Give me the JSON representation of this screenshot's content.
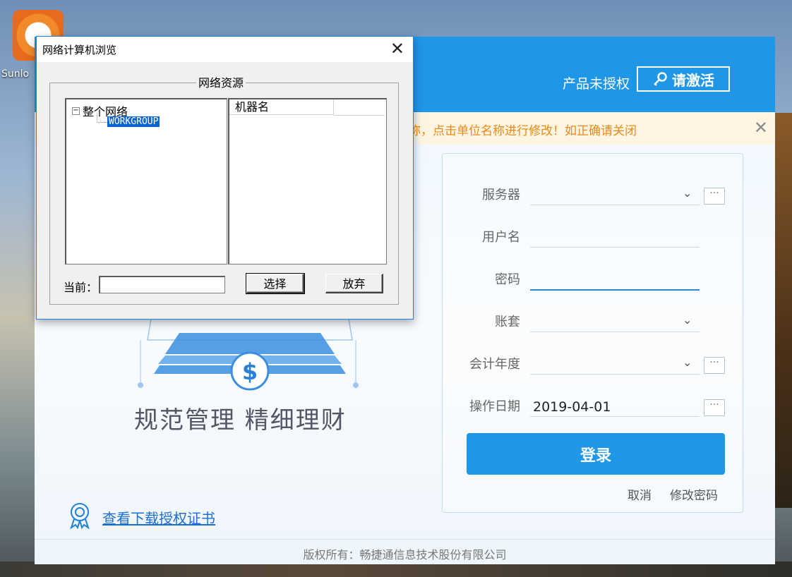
{
  "desktop": {
    "icon_label": "Sunlo"
  },
  "app": {
    "header": {
      "unauth_text": "产品未授权",
      "activate_label": "请激活",
      "activate_icon": "key-icon"
    },
    "notice": {
      "text": "称，点击单位名称进行修改！如正确请关闭",
      "close": "✕"
    },
    "login": {
      "server_label": "服务器",
      "username_label": "用户名",
      "password_label": "密码",
      "account_label": "账套",
      "fiscal_year_label": "会计年度",
      "op_date_label": "操作日期",
      "op_date_value": "2019-04-01",
      "dots": "···",
      "login_button": "登录",
      "cancel_link": "取消",
      "change_password_link": "修改密码"
    },
    "slogan": "规范管理  精细理财",
    "cert_link": "查看下载授权证书",
    "copyright": "版权所有：畅捷通信息技术股份有限公司",
    "colors": {
      "brand_blue": "#1f96e6",
      "notice_orange": "#e98a1a"
    }
  },
  "dialog": {
    "title": "网络计算机浏览",
    "close": "✕",
    "group_caption": "网络资源",
    "tree": {
      "root_label": "整个网络",
      "expander": "−",
      "child_label": "WORKGROUP"
    },
    "list": {
      "column_header": "机器名"
    },
    "current_label": "当前：",
    "current_value": "",
    "select_button": "选择",
    "discard_button": "放弃"
  }
}
